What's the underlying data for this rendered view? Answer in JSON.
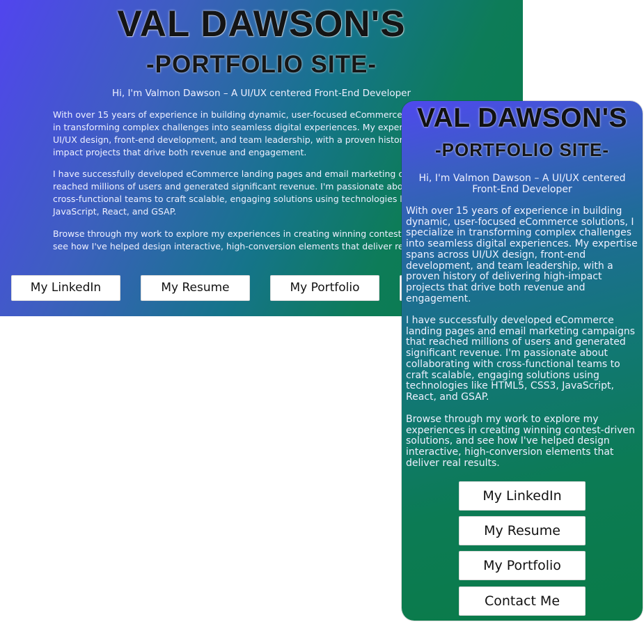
{
  "site": {
    "title": "VAL DAWSON'S",
    "subtitle": "-PORTFOLIO SITE-",
    "intro": "Hi, I'm Valmon Dawson – A UI/UX centered Front-End Developer",
    "paragraphs": [
      "With over 15 years of experience in building dynamic, user-focused eCommerce solutions, I specialize in transforming complex challenges into seamless digital experiences. My expertise spans across UI/UX design, front-end development, and team leadership, with a proven history of delivering high-impact projects that drive both revenue and engagement.",
      "I have successfully developed eCommerce landing pages and email marketing campaigns that reached millions of users and generated significant revenue. I'm passionate about collaborating with cross-functional teams to craft scalable, engaging solutions using technologies like HTML5, CSS3, JavaScript, React, and GSAP.",
      "Browse through my work to explore my experiences in creating winning contest-driven solutions, and see how I've helped design interactive, high-conversion elements that deliver real results."
    ],
    "buttons": {
      "linkedin": "My LinkedIn",
      "resume": "My Resume",
      "portfolio": "My Portfolio",
      "contact": "Contact Me"
    }
  },
  "colors": {
    "gradient_start": "#5145ee",
    "gradient_mid": "#15748a",
    "gradient_end": "#0a7c48",
    "button_bg": "#ffffff",
    "title_text": "#141414",
    "body_text": "#eef0ff"
  }
}
